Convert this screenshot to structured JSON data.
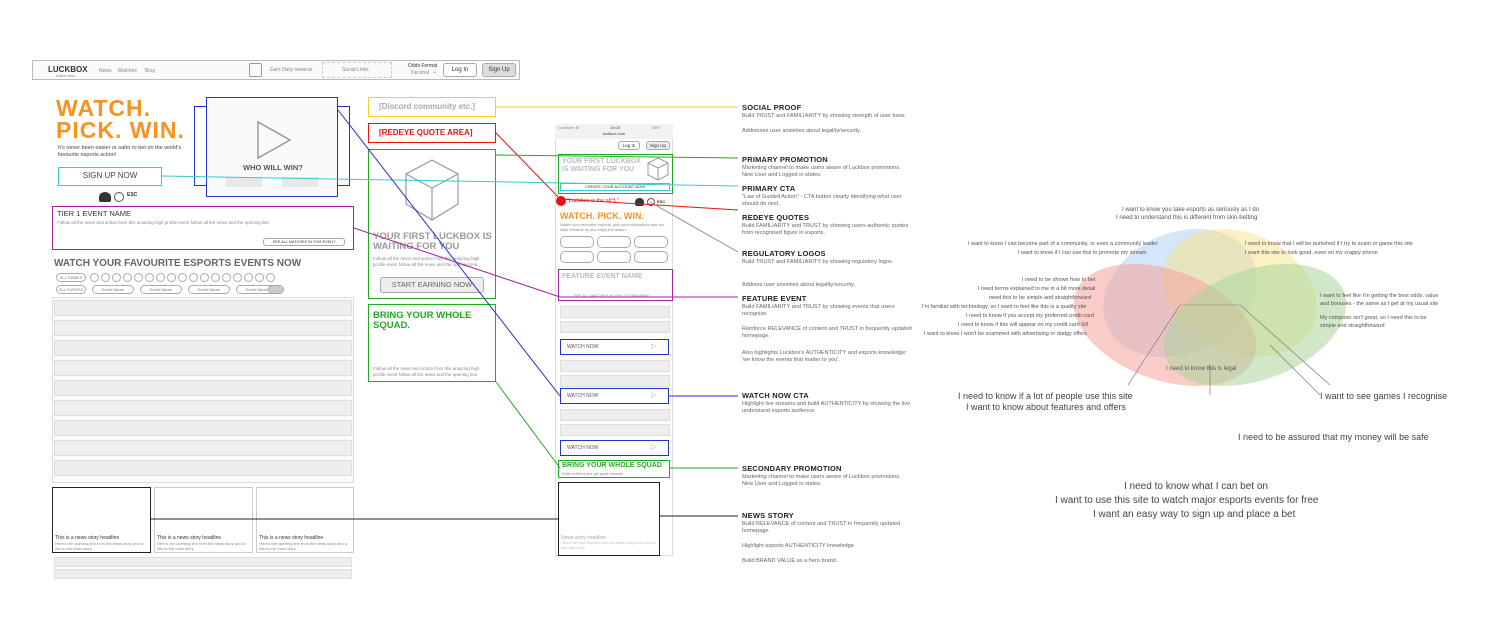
{
  "desktop": {
    "logo": "LUCKBOX",
    "logo_sub": "online bets",
    "nav": [
      "News",
      "Matches",
      "Blog"
    ],
    "earn": "Earn Daily rewards",
    "social_links": "Social Links",
    "odds_label": "Odds Format",
    "odds_value": "Decimal",
    "login": "Log In",
    "signup": "Sign Up",
    "hero_line1": "WATCH.",
    "hero_line2": "PICK. WIN.",
    "hero_sub": "It's never been easier or safer to bet on the world's favourite esports action!",
    "signup_now": "SIGN UP NOW",
    "who_will_win": "WHO WILL WIN?",
    "tier1_title": "TIER 1 EVENT NAME",
    "tier1_desc": "Follow all the news and action from this amazing high profile event follow all the news and the opening line",
    "see_all": "SEE ALL MATCHES IN THIS EVENT",
    "watch_fav": "WATCH YOUR FAVOURITE ESPORTS EVENTS NOW",
    "all_games": "ALL GAMES",
    "all_events": "ALL EVENTS",
    "event_item": "Event Name",
    "news_headline": "This is a news story headline",
    "news_desc": "Here's the opening line from the news story and a link to the main story"
  },
  "middle": {
    "discord": "[Discord community etc.]",
    "redeye": "[REDEYE QUOTE AREA]",
    "promo_title": "YOUR FIRST LUCKBOX IS WAITING FOR YOU",
    "promo_desc": "Follow all the news and action from this amazing high profile event follow all the news and the opening line",
    "start_earning": "START EARNING NOW",
    "squad_title": "BRING YOUR WHOLE SQUAD.",
    "squad_desc": "Follow all the news and action from this amazing high profile event follow all the news and the opening line"
  },
  "mobile": {
    "status": "vodafone IE",
    "time": "14:03",
    "battery": "98%",
    "url": "luckbox.com",
    "login": "Log In",
    "signup": "Sign Up",
    "promo": "YOUR FIRST LUCKBOX IS WAITING FOR YOU",
    "create_account": "CREATE YOUR ACCOUNT NOW",
    "quote": "\"Luckbox is the sh*t.\"",
    "hero": "WATCH. PICK. WIN.",
    "hero_sub": "Watch your favourite esports, pick your champions and win daily rewards as you enjoy the action.",
    "feature_event": "FEATURE EVENT NAME",
    "see_all": "SEE ALL MATCHES IN THIS TOURNAMENT",
    "watch_now": "WATCH NOW",
    "squad": "BRING YOUR WHOLE SQUAD",
    "squad_sub": "Refer a friend and get great rewards",
    "news_headline": "News story headline",
    "news_desc": "Here's the opening line from the news story and a link to the main story"
  },
  "annotations": [
    {
      "title": "SOCIAL PROOF",
      "desc": [
        "Build TRUST and FAMILIARITY by showing strength of user base.",
        "",
        "Addresses user anxieties about legality/security."
      ]
    },
    {
      "title": "PRIMARY PROMOTION",
      "desc": [
        "Marketing channel to make users aware of Luckbox promotions. New User and Logged in states."
      ]
    },
    {
      "title": "PRIMARY CTA",
      "desc": [
        "\"Law of Guided Action\" - CTA button clearly identifying what user should do next."
      ]
    },
    {
      "title": "REDEYE QUOTES",
      "desc": [
        "Build FAMILIARITY and TRUST by showing users authentic quotes from recognised figure in esports."
      ]
    },
    {
      "title": "REGULATORY LOGOS",
      "desc": [
        "Build TRUST and FAMILIARITY by showing regulatory logos.",
        "",
        "Address user anxieties about legality/security."
      ]
    },
    {
      "title": "FEATURE EVENT",
      "desc": [
        "Build FAMILIARITY and TRUST by showing events that users recognise.",
        "",
        "Reinforce RELEVANCE of content and TRUST in frequently updated homepage.",
        "",
        "Also highlights Luckbox's AUTHENTICITY and esports knowledge: 'we know the events that matter to you'."
      ]
    },
    {
      "title": "WATCH NOW CTA",
      "desc": [
        "Highlight live streams and build AUTHENTICITY by showing the live understand esports audience."
      ]
    },
    {
      "title": "SECONDARY PROMOTION",
      "desc": [
        "Marketing channel to make users aware of Luckbox promotions. New User and Logged in states."
      ]
    },
    {
      "title": "NEWS STORY",
      "desc": [
        "Build RELEVANCE of content and TRUST in frequently updated homepage.",
        "",
        "Highlight esports AUTHENTICITY knowledge.",
        "",
        "Build BRAND VALUE as a hero brand."
      ]
    }
  ],
  "venn": {
    "top": [
      "I want to know you take esports as seriously as I do",
      "I need to understand this is different from skin-betting"
    ],
    "left_group": [
      "I want to know I can become part of a community, or even a community leader",
      "I want to know if I can use this to promote my stream"
    ],
    "right_group": [
      "I need to know that I will be punished if I try to scam or game this site",
      "I want this site to look good, even on my crappy phone"
    ],
    "mid_left": [
      "I need to be shown how to bet",
      "I need terms explained to me in a bit more detail",
      "need this to be simple and straightforward",
      "I'm familiar with technology, so I want to feel like this is a quality site",
      "I need to know if you accept my preferred credit card",
      "I need to know if this will appear on my credit card bill",
      "I want to know I won't be scammed with advertising or dodgy offers"
    ],
    "mid_right": [
      "I want to feel like I'm getting the best odds, value and bonuses - the same as I get at my usual site",
      "My computer isn't great, so I need this to be simple and straightforward"
    ],
    "center": "I need to know this is legal",
    "label_left": [
      "I need to know if a lot of people use this site",
      "I want to know about features and offers"
    ],
    "label_right": "I want to see games I recognise",
    "label_bottom_right": "I need to be assured that my money will be safe",
    "bottom": [
      "I need to know what I can bet on",
      "I want to use this site to watch major esports events for free",
      "I want an easy way to sign up and place a bet"
    ]
  },
  "colors": {
    "orange": "#f7931e",
    "green": "#22aa22",
    "blue": "#2233cc",
    "red": "#ee1111",
    "cyan": "#33cccc",
    "yellow": "#f5d020",
    "purple": "#aa2299",
    "black": "#222222",
    "gray": "#888888"
  }
}
